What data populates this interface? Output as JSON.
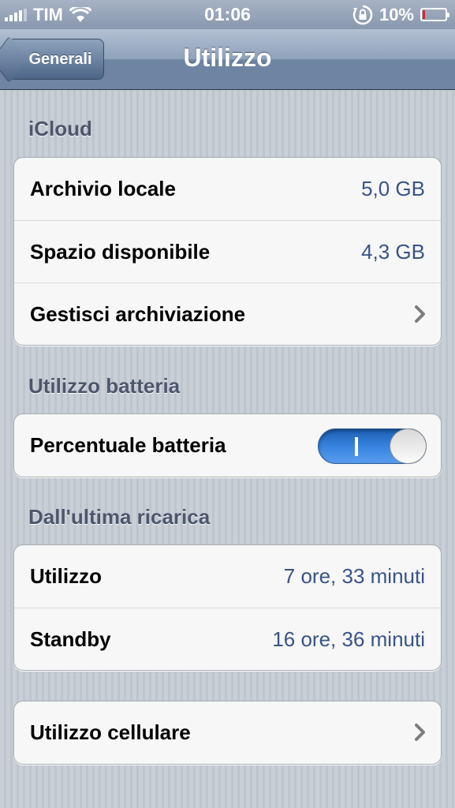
{
  "status_bar": {
    "carrier": "TIM",
    "time": "01:06",
    "battery_percent": "10%",
    "battery_level": 0.1,
    "battery_color": "#e0262c"
  },
  "nav": {
    "back_label": "Generali",
    "title": "Utilizzo"
  },
  "icloud": {
    "header": "iCloud",
    "rows": [
      {
        "label": "Archivio locale",
        "value": "5,0 GB"
      },
      {
        "label": "Spazio disponibile",
        "value": "4,3 GB"
      },
      {
        "label": "Gestisci archiviazione"
      }
    ]
  },
  "battery": {
    "header": "Utilizzo batteria",
    "percentage_label": "Percentuale batteria",
    "percentage_on": true
  },
  "since_charge": {
    "header": "Dall'ultima ricarica",
    "rows": [
      {
        "label": "Utilizzo",
        "value": "7 ore, 33 minuti"
      },
      {
        "label": "Standby",
        "value": "16 ore, 36 minuti"
      }
    ]
  },
  "cellular": {
    "label": "Utilizzo cellulare"
  },
  "colors": {
    "value_text": "#385487",
    "toggle_on": "#3a86e0"
  }
}
